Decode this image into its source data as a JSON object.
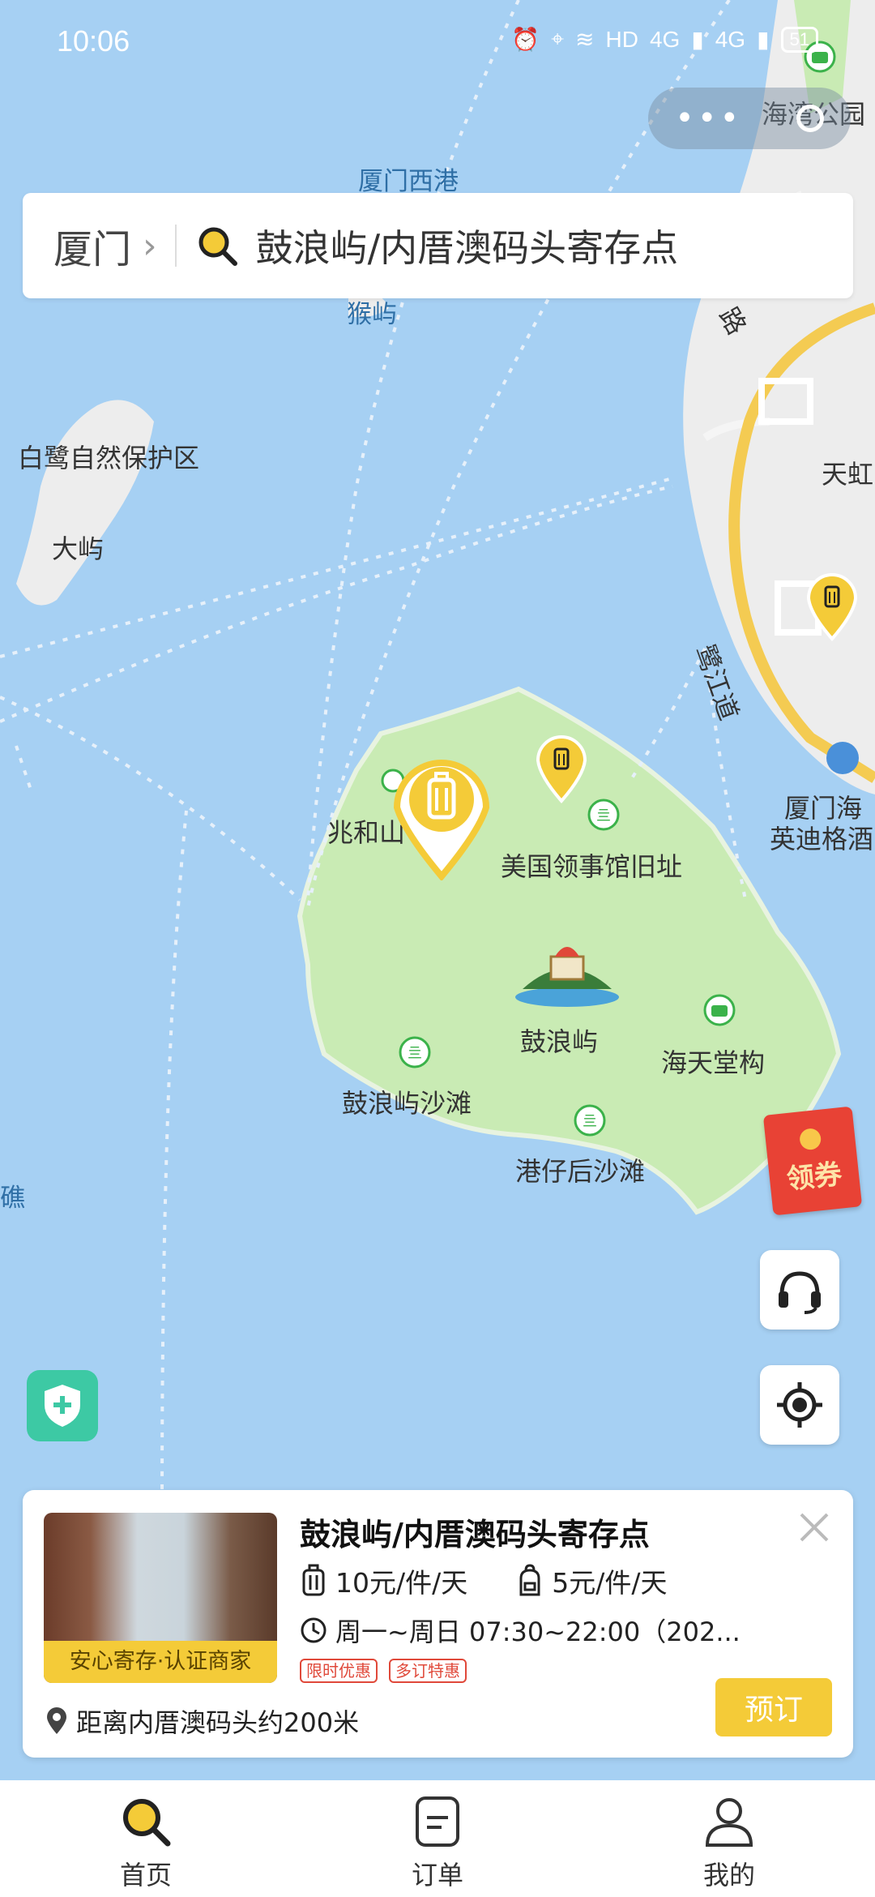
{
  "status_bar": {
    "time": "10:06",
    "network": "HD",
    "signal1": "4G",
    "signal2": "4G",
    "battery": "51"
  },
  "search": {
    "city": "厦门",
    "query": "鼓浪屿/内厝澳码头寄存点"
  },
  "map_labels": {
    "west_harbor": "厦门西港",
    "hou_islet": "猴屿",
    "egret_reserve": "白鹭自然保护区",
    "da_islet": "大屿",
    "zhaohe": "兆和山",
    "us_consulate": "美国领事馆旧址",
    "gulangyu": "鼓浪屿",
    "haitian": "海天堂构",
    "gly_beach": "鼓浪屿沙滩",
    "gangzaihou": "港仔后沙滩",
    "jiao": "礁",
    "haiwan_park": "海湾公园",
    "tianhong": "天虹",
    "lujiang_road": "鹭江道",
    "road_lu": "路",
    "xiamen_hotel_1": "厦门海",
    "xiamen_hotel_2": "英迪格酒"
  },
  "coupon": {
    "label": "领券"
  },
  "card": {
    "title": "鼓浪屿/内厝澳码头寄存点",
    "badge": "安心寄存·认证商家",
    "price_luggage": "10元/件/天",
    "price_bag": "5元/件/天",
    "hours": "周一~周日 07:30~22:00（202...",
    "tags": [
      "限时优惠",
      "多订特惠"
    ],
    "distance": "距离内厝澳码头约200米",
    "book_label": "预订"
  },
  "tabs": [
    {
      "label": "首页",
      "icon": "search-icon"
    },
    {
      "label": "订单",
      "icon": "order-icon"
    },
    {
      "label": "我的",
      "icon": "user-icon"
    }
  ],
  "colors": {
    "accent": "#f4cb38",
    "water": "#a6d0f3",
    "land": "#c9ebb4",
    "shield": "#3dc9a4"
  }
}
